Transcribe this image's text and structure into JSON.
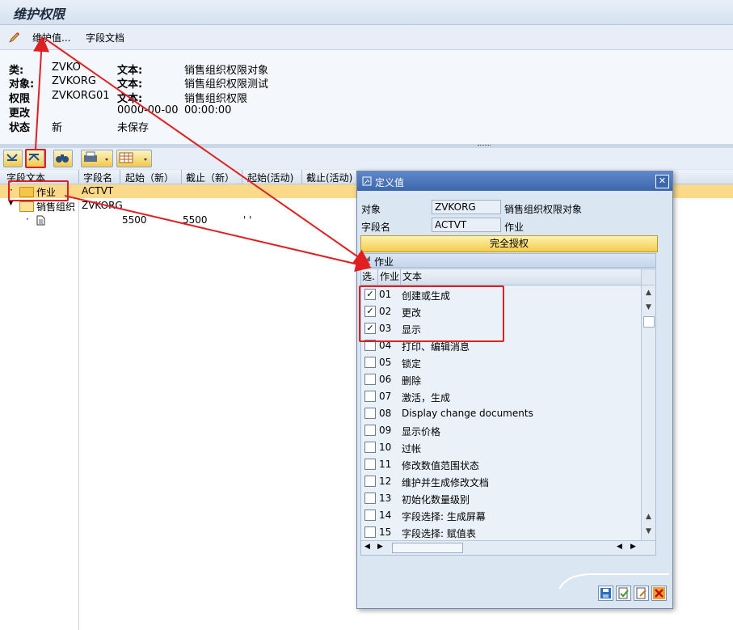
{
  "window": {
    "title": "维护权限"
  },
  "toolbar": {
    "maintain_values": "维护值...",
    "field_docs": "字段文档",
    "icon": "pencil-icon"
  },
  "header": {
    "rows": [
      {
        "label": "类:",
        "value": "ZVKO",
        "text_label": "文本:",
        "text": "销售组织权限对象"
      },
      {
        "label": "对象:",
        "value": "ZVKORG",
        "text_label": "文本:",
        "text": "销售组织权限测试"
      },
      {
        "label": "权限",
        "value": "ZVKORG01",
        "text_label": "文本:",
        "text": "销售组织权限"
      },
      {
        "label": "更改",
        "value": "",
        "text_label": "0000-00-00",
        "text": "00:00:00"
      },
      {
        "label": "状态",
        "value": "新",
        "text_label": "未保存",
        "text": ""
      }
    ]
  },
  "tree": {
    "columns": [
      "字段文本",
      "字段名",
      "起始（新）",
      "截止（新）",
      "起始(活动)",
      "截止(活动)"
    ],
    "rows": [
      {
        "text": "作业",
        "field": "ACTVT",
        "from_new": "",
        "to_new": "",
        "from_active": ""
      },
      {
        "text": "销售组织",
        "field": "ZVKORG",
        "from_new": "",
        "to_new": "",
        "from_active": ""
      },
      {
        "text": "",
        "field": "",
        "from_new": "5500",
        "to_new": "5500",
        "from_active": "' '"
      }
    ]
  },
  "dialog": {
    "title": "定义值",
    "object_label": "对象",
    "object_value": "ZVKORG",
    "object_text": "销售组织权限对象",
    "field_label": "字段名",
    "field_value": "ACTVT",
    "field_text": "作业",
    "full_auth": "完全授权",
    "panel_title": "作业",
    "grid_headers": [
      "选.",
      "作业",
      "文本"
    ],
    "activities": [
      {
        "code": "01",
        "text": "创建或生成",
        "checked": true
      },
      {
        "code": "02",
        "text": "更改",
        "checked": true
      },
      {
        "code": "03",
        "text": "显示",
        "checked": true
      },
      {
        "code": "04",
        "text": "打印、编辑消息",
        "checked": false
      },
      {
        "code": "05",
        "text": "锁定",
        "checked": false
      },
      {
        "code": "06",
        "text": "删除",
        "checked": false
      },
      {
        "code": "07",
        "text": "激活，生成",
        "checked": false
      },
      {
        "code": "08",
        "text": "Display change documents",
        "checked": false
      },
      {
        "code": "09",
        "text": "显示价格",
        "checked": false
      },
      {
        "code": "10",
        "text": "过帐",
        "checked": false
      },
      {
        "code": "11",
        "text": "修改数值范围状态",
        "checked": false
      },
      {
        "code": "12",
        "text": "维护并生成修改文档",
        "checked": false
      },
      {
        "code": "13",
        "text": "初始化数量级别",
        "checked": false
      },
      {
        "code": "14",
        "text": "字段选择: 生成屏幕",
        "checked": false
      },
      {
        "code": "15",
        "text": "字段选择: 赋值表",
        "checked": false
      }
    ],
    "checkmark": "✓"
  },
  "colors": {
    "accent": "#3d67ad",
    "highlight": "#f8d77a",
    "annotation": "#e02020"
  }
}
